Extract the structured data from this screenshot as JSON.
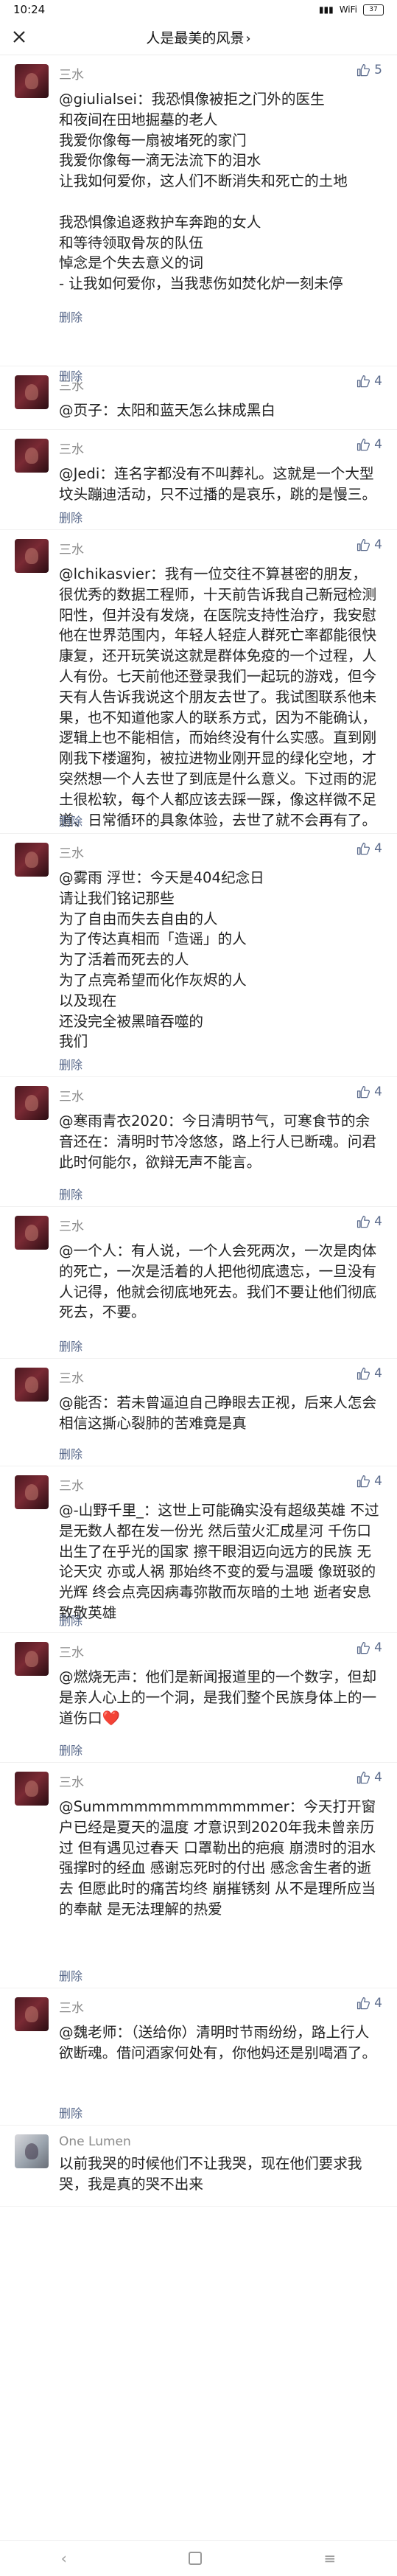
{
  "status_bar": {
    "time": "10:24",
    "signal": "▮▮▮",
    "wifi": "WiFi",
    "battery": "37"
  },
  "header": {
    "title": "人是最美的风景",
    "chevron": "›"
  },
  "comments": [
    {
      "name": "三水",
      "likes": "5",
      "text": "@giulialsei：我恐惧像被拒之门外的医生\n和夜间在田地掘墓的老人\n我爱你像每一扇被堵死的家门\n我爱你像每一滴无法流下的泪水\n让我如何爱你，这人们不断消失和死亡的土地\n\n我恐惧像追逐救护车奔跑的女人\n和等待领取骨灰的队伍\n悼念是个失去意义的词\n- 让我如何爱你，当我悲伤如焚化炉一刻未停",
      "delete": "删除"
    },
    {
      "name": "三水",
      "likes": "4",
      "text": "@页子：太阳和蓝天怎么抹成黑白",
      "delete": "删除"
    },
    {
      "name": "三水",
      "likes": "4",
      "text": "@Jedi：连名字都没有不叫葬礼。这就是一个大型坟头蹦迪活动，只不过播的是哀乐，跳的是慢三。",
      "delete": "删除"
    },
    {
      "name": "三水",
      "likes": "4",
      "text": "@lchikasvier：我有一位交往不算甚密的朋友，很优秀的数据工程师，十天前告诉我自己新冠检测阳性，但并没有发烧，在医院支持性治疗，我安慰他在世界范围内，年轻人轻症人群死亡率都能很快康复，还开玩笑说这就是群体免疫的一个过程，人人有份。七天前他还登录我们一起玩的游戏，但今天有人告诉我说这个朋友去世了。我试图联系他未果，也不知道他家人的联系方式，因为不能确认，逻辑上也不能相信，而始终没有什么实感。直到刚刚我下楼遛狗，被拉进物业刚开显的绿化空地，才突然想一个人去世了到底是什么意义。下过雨的泥土很松软，每个人都应该去踩一踩，像这样微不足道、日常循环的具象体验，去世了就不会再有了。",
      "delete": "删除"
    },
    {
      "name": "三水",
      "likes": "4",
      "text": "@雾雨 浮世：今天是404纪念日\n请让我们铭记那些\n为了自由而失去自由的人\n为了传达真相而「造谣」的人\n为了活着而死去的人\n为了点亮希望而化作灰烬的人\n以及现在\n还没完全被黑暗吞噬的\n我们",
      "delete": "删除"
    },
    {
      "name": "三水",
      "likes": "4",
      "text": "@寒雨青衣2020：今日清明节气，可寒食节的余音还在：清明时节冷悠悠，路上行人已断魂。问君此时何能尔，欲辩无声不能言。",
      "delete": "删除"
    },
    {
      "name": "三水",
      "likes": "4",
      "text": "@一个人：有人说，一个人会死两次，一次是肉体的死亡，一次是活着的人把他彻底遗忘，一旦没有人记得，他就会彻底地死去。我们不要让他们彻底死去，不要。",
      "delete": "删除"
    },
    {
      "name": "三水",
      "likes": "4",
      "text": "@能否：若未曾逼迫自己睁眼去正视，后来人怎会相信这撕心裂肺的苦难竟是真",
      "delete": "删除"
    },
    {
      "name": "三水",
      "likes": "4",
      "text": "@-山野千里_：这世上可能确实没有超级英雄 不过是无数人都在发一份光 然后萤火汇成星河 千伤口出生了在乎光的国家 擦干眼泪迈向远方的民族 无论天灾 亦或人祸 那始终不变的爱与温暖 像斑驳的光辉 终会点亮因病毒弥散而灰暗的土地 逝者安息 致敬英雄",
      "delete": "删除"
    },
    {
      "name": "三水",
      "likes": "4",
      "text": "@燃烧无声：他们是新闻报道里的一个数字，但却是亲人心上的一个洞，是我们整个民族身体上的一道伤口❤️",
      "delete": "删除"
    },
    {
      "name": "三水",
      "likes": "4",
      "text": "@Summmmmmmmmmmmmer：今天打开窗户已经是夏天的温度 才意识到2020年我未曾亲历过 但有遇见过春天 口罩勒出的疤痕 崩溃时的泪水 强撑时的经血 感谢忘死时的付出 感念舍生者的逝去 但愿此时的痛苦均终 崩摧锈刻 从不是理所应当的奉献 是无法理解的热爱",
      "delete": "删除"
    },
    {
      "name": "三水",
      "likes": "4",
      "text": "@魏老师：（送给你）清明时节雨纷纷，路上行人欲断魂。借问酒家何处有，你他妈还是别喝酒了。",
      "delete": "删除"
    },
    {
      "name": "One Lumen",
      "likes": "",
      "text": "以前我哭的时候他们不让我哭，现在他们要求我哭，我是真的哭不出来",
      "delete": ""
    }
  ],
  "bottom_nav": {
    "back": "‹",
    "home": "",
    "menu": "≡"
  }
}
